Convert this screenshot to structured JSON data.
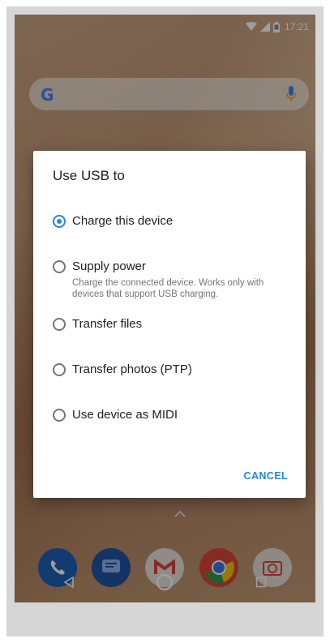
{
  "status_bar": {
    "time": "17:21"
  },
  "search": {
    "logo": "G",
    "mic_icon": "mic-icon"
  },
  "dialog": {
    "title": "Use USB to",
    "options": [
      {
        "label": "Charge this device",
        "description": "",
        "checked": true
      },
      {
        "label": "Supply power",
        "description": "Charge the connected device. Works only with devices that support USB charging.",
        "checked": false
      },
      {
        "label": "Transfer files",
        "description": "",
        "checked": false
      },
      {
        "label": "Transfer photos (PTP)",
        "description": "",
        "checked": false
      },
      {
        "label": "Use device as MIDI",
        "description": "",
        "checked": false
      }
    ],
    "cancel_label": "CANCEL"
  },
  "dock": {
    "apps": [
      "phone-icon",
      "messages-icon",
      "gmail-icon",
      "chrome-icon",
      "camera-icon"
    ]
  },
  "navigation": {
    "icons": [
      "back-icon",
      "home-icon",
      "recents-icon"
    ]
  },
  "colors": {
    "accent": "#1e88e5"
  }
}
